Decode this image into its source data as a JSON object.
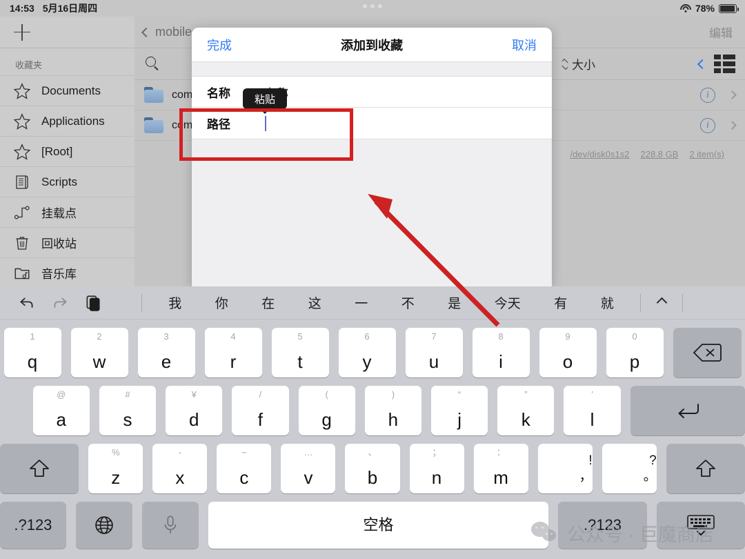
{
  "status_bar": {
    "time": "14:53",
    "date": "5月16日周四",
    "battery_percent": "78%",
    "wifi_icon": "wifi-icon",
    "battery_icon": "battery-icon"
  },
  "sidebar": {
    "add_icon": "plus-icon",
    "section_title": "收藏夹",
    "items": [
      {
        "label": "Documents",
        "icon": "star-icon"
      },
      {
        "label": "Applications",
        "icon": "star-icon"
      },
      {
        "label": "[Root]",
        "icon": "star-icon"
      },
      {
        "label": "Scripts",
        "icon": "script-icon"
      },
      {
        "label": "挂载点",
        "icon": "mount-point-icon"
      },
      {
        "label": "回收站",
        "icon": "trash-icon"
      },
      {
        "label": "音乐库",
        "icon": "music-library-icon"
      }
    ]
  },
  "main": {
    "back_label": "mobile",
    "edit_label": "编辑",
    "search_icon": "search-icon",
    "sort_label": "大小",
    "grid_icon": "grid-view-icon",
    "files": [
      {
        "name": "com",
        "icon": "folder-icon"
      },
      {
        "name": "com",
        "icon": "folder-icon"
      }
    ],
    "disk_info": {
      "device": "/dev/disk0s1s2",
      "size": "228.8 GB",
      "items": "2 item(s)"
    }
  },
  "modal": {
    "done_label": "完成",
    "title": "添加到收藏",
    "cancel_label": "取消",
    "rows": [
      {
        "label": "名称",
        "value": "",
        "placeholder": "名称"
      },
      {
        "label": "路径",
        "value": "",
        "placeholder": ""
      }
    ],
    "paste_tooltip": "粘贴"
  },
  "keyboard": {
    "tools": [
      {
        "name": "undo-icon"
      },
      {
        "name": "redo-icon"
      },
      {
        "name": "paste-icon"
      }
    ],
    "suggestions": [
      "我",
      "你",
      "在",
      "这",
      "一",
      "不",
      "是",
      "今天",
      "有",
      "就"
    ],
    "collapse_icon": "caret-up-icon",
    "row1": [
      {
        "main": "q",
        "sub": "1"
      },
      {
        "main": "w",
        "sub": "2"
      },
      {
        "main": "e",
        "sub": "3"
      },
      {
        "main": "r",
        "sub": "4"
      },
      {
        "main": "t",
        "sub": "5"
      },
      {
        "main": "y",
        "sub": "6"
      },
      {
        "main": "u",
        "sub": "7"
      },
      {
        "main": "i",
        "sub": "8"
      },
      {
        "main": "o",
        "sub": "9"
      },
      {
        "main": "p",
        "sub": "0"
      }
    ],
    "backspace_icon": "backspace-icon",
    "row2": [
      {
        "main": "a",
        "sub": "@"
      },
      {
        "main": "s",
        "sub": "#"
      },
      {
        "main": "d",
        "sub": "¥"
      },
      {
        "main": "f",
        "sub": "/"
      },
      {
        "main": "g",
        "sub": "("
      },
      {
        "main": "h",
        "sub": ")"
      },
      {
        "main": "j",
        "sub": "“"
      },
      {
        "main": "k",
        "sub": "”"
      },
      {
        "main": "l",
        "sub": "’"
      }
    ],
    "return_icon": "return-icon",
    "shift_left_icon": "shift-icon",
    "row3": [
      {
        "main": "z",
        "sub": "%"
      },
      {
        "main": "x",
        "sub": "-"
      },
      {
        "main": "c",
        "sub": "~"
      },
      {
        "main": "v",
        "sub": "…"
      },
      {
        "main": "b",
        "sub": "、"
      },
      {
        "main": "n",
        "sub": "；"
      },
      {
        "main": "m",
        "sub": "："
      }
    ],
    "punct_keys": [
      {
        "top": "!",
        "bottom": "，"
      },
      {
        "top": "?",
        "bottom": "。"
      }
    ],
    "shift_right_icon": "shift-icon",
    "bottom": {
      "numbers_left": ".?123",
      "globe_icon": "globe-icon",
      "mic_icon": "microphone-icon",
      "space_label": "空格",
      "numbers_right": ".?123",
      "hide_keyboard_icon": "hide-keyboard-icon"
    }
  },
  "watermark": {
    "text": "公众号 · 巨魔商店",
    "logo": "wechat-logo"
  },
  "annotations": {
    "highlight_box": "red-highlight-rectangle",
    "arrow": "red-arrow"
  }
}
